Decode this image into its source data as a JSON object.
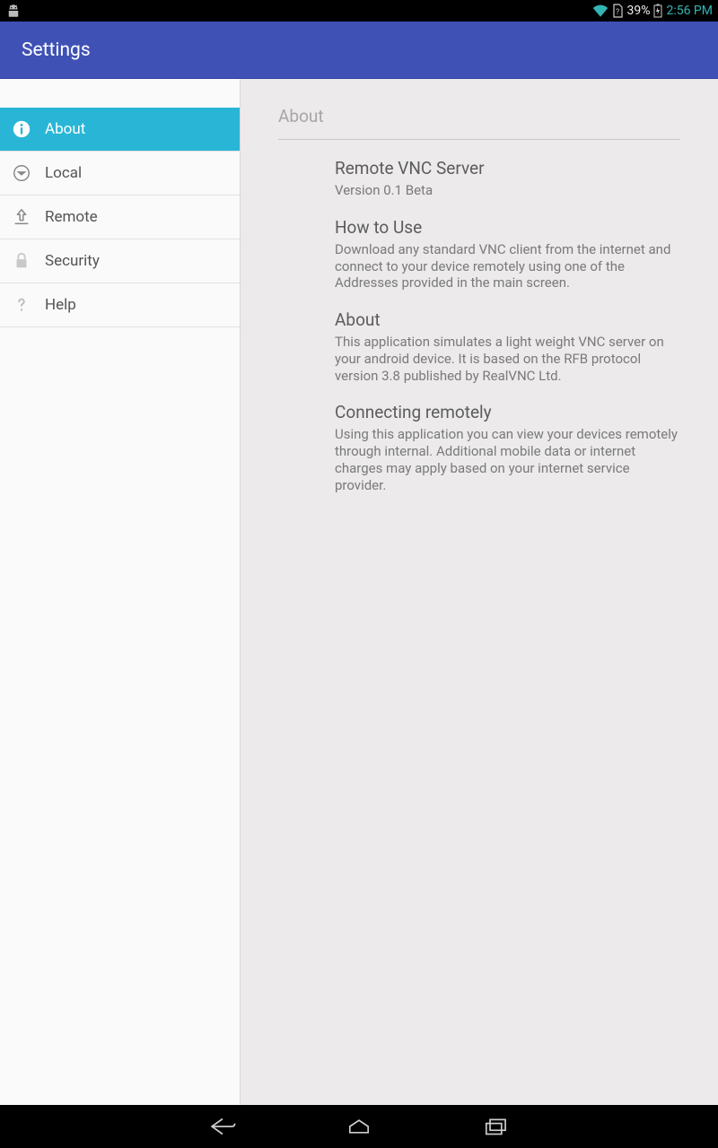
{
  "status": {
    "battery_pct": "39%",
    "time": "2:56 PM"
  },
  "appbar": {
    "title": "Settings"
  },
  "sidebar": {
    "items": [
      {
        "label": "About",
        "active": true
      },
      {
        "label": "Local",
        "active": false
      },
      {
        "label": "Remote",
        "active": false
      },
      {
        "label": "Security",
        "active": false
      },
      {
        "label": "Help",
        "active": false
      }
    ]
  },
  "content": {
    "title": "About",
    "sections": [
      {
        "heading": "Remote VNC Server",
        "body": "Version 0.1 Beta"
      },
      {
        "heading": "How to Use",
        "body": "Download any standard VNC client from the internet and connect to your device remotely using one of the Addresses provided in the main screen."
      },
      {
        "heading": "About",
        "body": "This application simulates a light weight VNC server on your android device. It is based on the RFB protocol version 3.8 published by RealVNC Ltd."
      },
      {
        "heading": "Connecting remotely",
        "body": "Using this application you can view your devices remotely through internal. Additional mobile data or internet charges may apply based on your internet service provider."
      }
    ]
  }
}
